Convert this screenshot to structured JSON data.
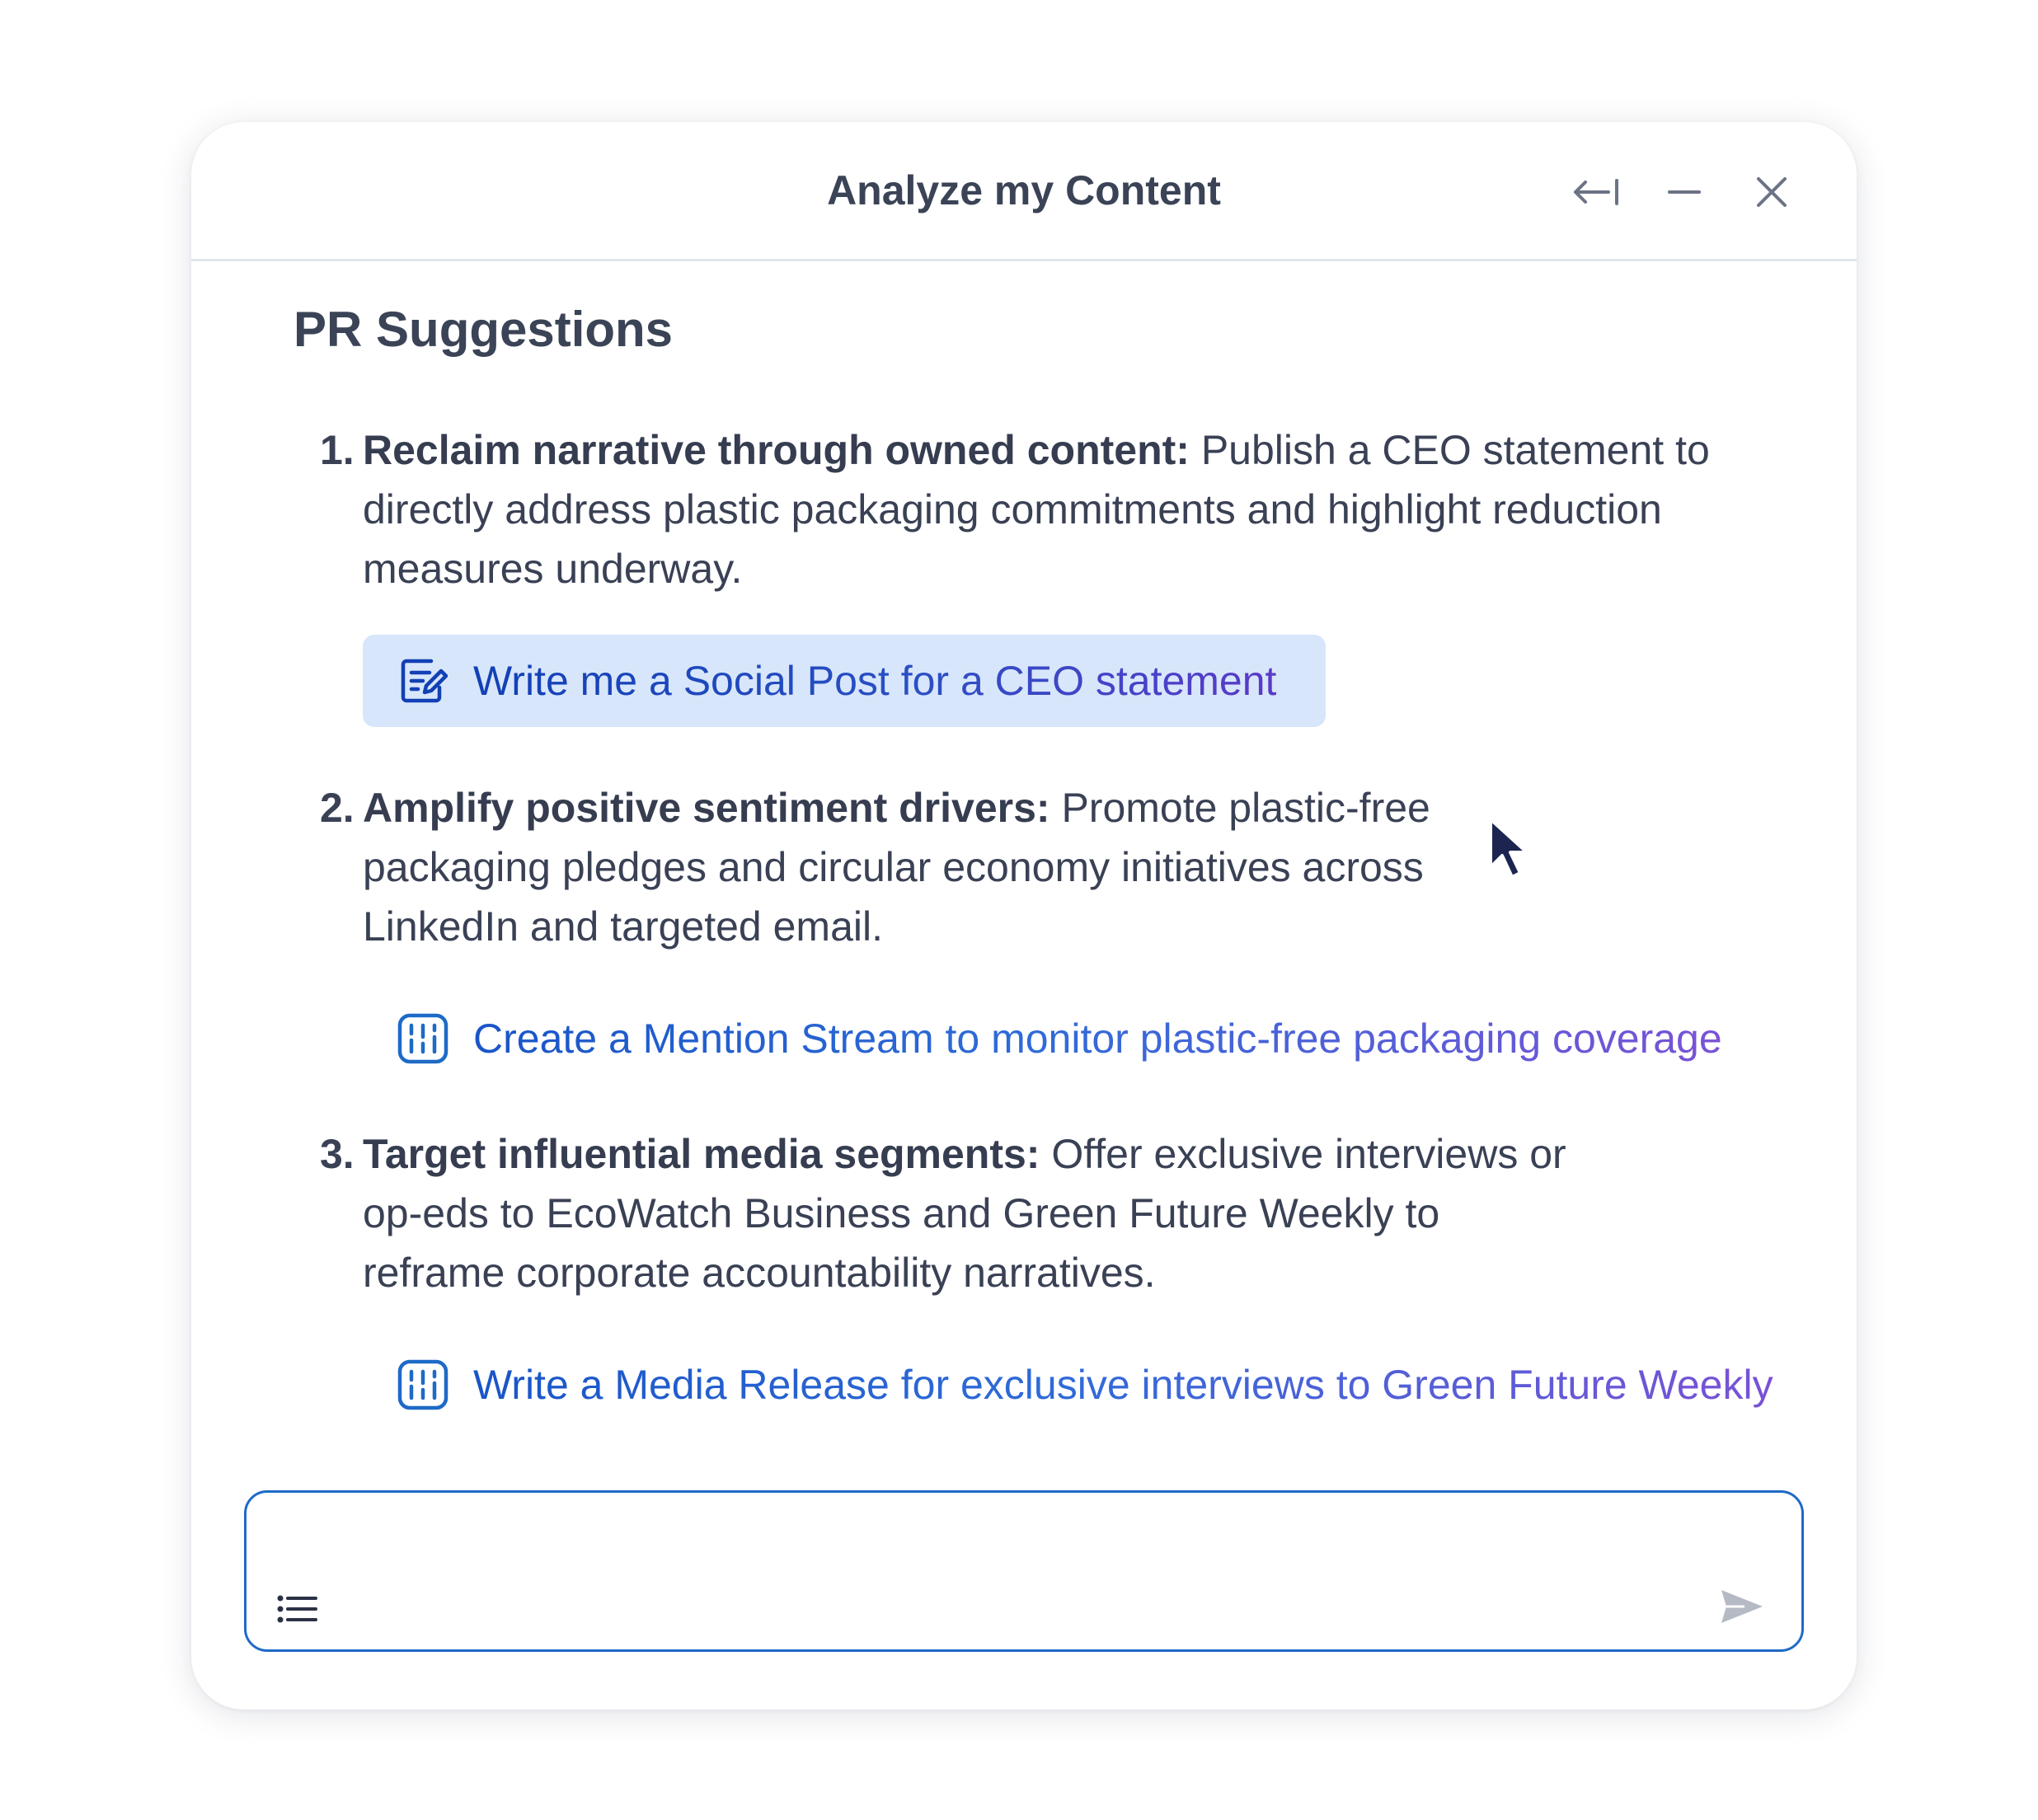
{
  "window": {
    "title": "Analyze my Content"
  },
  "header": {
    "buttons": [
      {
        "name": "collapse",
        "icon": "arrow-left-bar-icon"
      },
      {
        "name": "minimize",
        "icon": "minus-icon"
      },
      {
        "name": "close",
        "icon": "close-icon"
      }
    ]
  },
  "section": {
    "title": "PR Suggestions"
  },
  "suggestions": [
    {
      "number": "1.",
      "heading": "Reclaim narrative through owned content:",
      "body": "Publish a CEO statement to directly address plastic packaging commitments and highlight reduction measures underway.",
      "action": {
        "label": "Write me a Social Post for a CEO statement",
        "icon": "edit-document-icon",
        "highlighted": true
      }
    },
    {
      "number": "2.",
      "heading": "Amplify positive sentiment drivers:",
      "body": "Promote plastic-free packaging pledges and circular economy initiatives across LinkedIn and targeted email.",
      "action": {
        "label": "Create a Mention Stream to monitor plastic-free packaging coverage",
        "icon": "stream-icon",
        "highlighted": false
      }
    },
    {
      "number": "3.",
      "heading": "Target influential media segments:",
      "body": "Offer exclusive interviews or op-eds to EcoWatch Business and Green Future Weekly to reframe corporate accountability narratives.",
      "action": {
        "label": "Write a Media Release for exclusive interviews to Green Future Weekly",
        "icon": "stream-icon",
        "highlighted": false
      }
    }
  ],
  "composer": {
    "value": "",
    "placeholder": "",
    "list_icon": "list-icon",
    "send_icon": "send-icon"
  },
  "colors": {
    "title_text": "#3b4356",
    "body_text": "#3a4155",
    "link_start": "#1a55c7",
    "link_end": "#7a52d6",
    "highlight_bg": "#d8e6fb",
    "input_border": "#1e6ac7",
    "icon_blue": "#1e6ac7"
  }
}
